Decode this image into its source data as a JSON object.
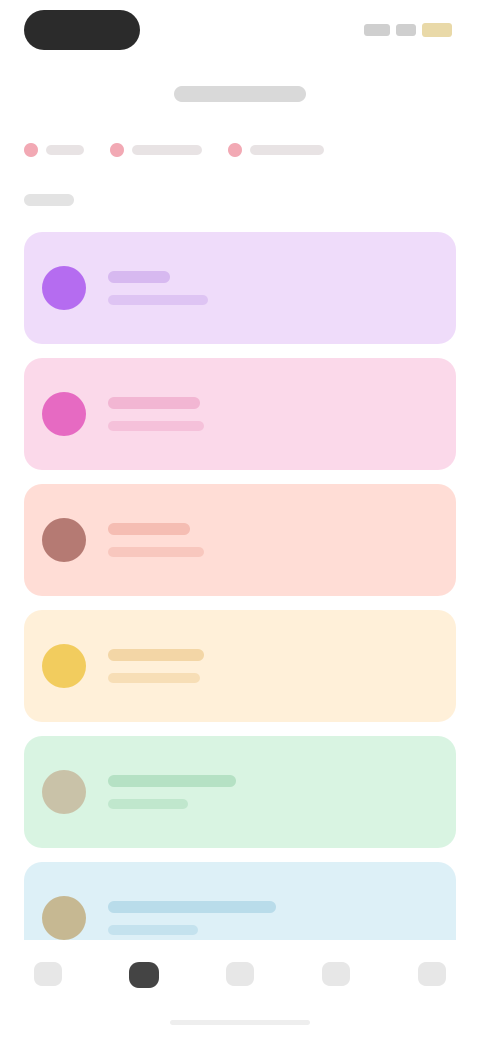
{
  "colors": {
    "card_backgrounds": [
      "#efdcfa",
      "#fbd9ea",
      "#ffddd6",
      "#fff0d9",
      "#d9f4e2",
      "#ddf0f7"
    ],
    "avatar_colors": [
      "#b56cf0",
      "#e66ac2",
      "#b57a73",
      "#f2cc5e",
      "#c9c2a8",
      "#c6b892"
    ],
    "line_colors": [
      "#d7b9f0",
      "#f2b6d3",
      "#f5bdb3",
      "#f3d6a6",
      "#b5e1c4",
      "#b9dcea"
    ],
    "chip_dot": "#f2a9b4"
  },
  "icons": {
    "nav": [
      "home-icon",
      "activity-icon",
      "explore-icon",
      "notifications-icon",
      "profile-icon"
    ]
  },
  "nav": {
    "active_index": 1
  }
}
